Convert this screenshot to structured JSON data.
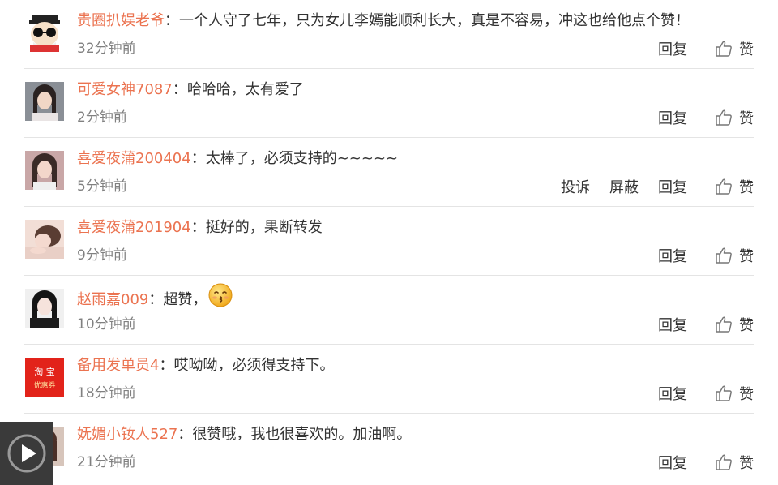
{
  "comments": [
    {
      "user": "贵圈扒娱老爷",
      "text": "一个人守了七年，只为女儿李嫣能顺利长大，真是不容易，冲这也给他点个赞！",
      "time": "32分钟前",
      "reply": "回复",
      "like": "赞",
      "avatar": "cartoon-sunglasses"
    },
    {
      "user": "可爱女神7087",
      "text": "哈哈哈，太有爱了",
      "time": "2分钟前",
      "reply": "回复",
      "like": "赞",
      "avatar": "photo-girl"
    },
    {
      "user": "喜爱夜蒲200404",
      "text": "太棒了，必须支持的~~~~~",
      "time": "5分钟前",
      "complain": "投诉",
      "block": "屏蔽",
      "reply": "回复",
      "like": "赞",
      "avatar": "photo-girl"
    },
    {
      "user": "喜爱夜蒲201904",
      "text": "挺好的，果断转发",
      "time": "9分钟前",
      "reply": "回复",
      "like": "赞",
      "avatar": "photo-girl"
    },
    {
      "user": "赵雨嘉009",
      "text": "超赞，",
      "time": "10分钟前",
      "reply": "回复",
      "like": "赞",
      "avatar": "photo-girl",
      "emoji": "kiss-emoji"
    },
    {
      "user": "备用发单员4",
      "text": "哎呦呦，必须得支持下。",
      "time": "18分钟前",
      "reply": "回复",
      "like": "赞",
      "avatar": "taobao-coupon",
      "avatar_text": {
        "line1": "淘  宝",
        "line2": "优惠券"
      }
    },
    {
      "user": "妩媚小钕人527",
      "text": "很赞哦，我也很喜欢的。加油啊。",
      "time": "21分钟前",
      "reply": "回复",
      "like": "赞",
      "avatar": "photo-girl"
    }
  ],
  "colors": {
    "username": "#eb7350",
    "text": "#333333",
    "time": "#808080",
    "divider": "#e4e4e4"
  },
  "overlay": {
    "icon": "play-icon"
  }
}
